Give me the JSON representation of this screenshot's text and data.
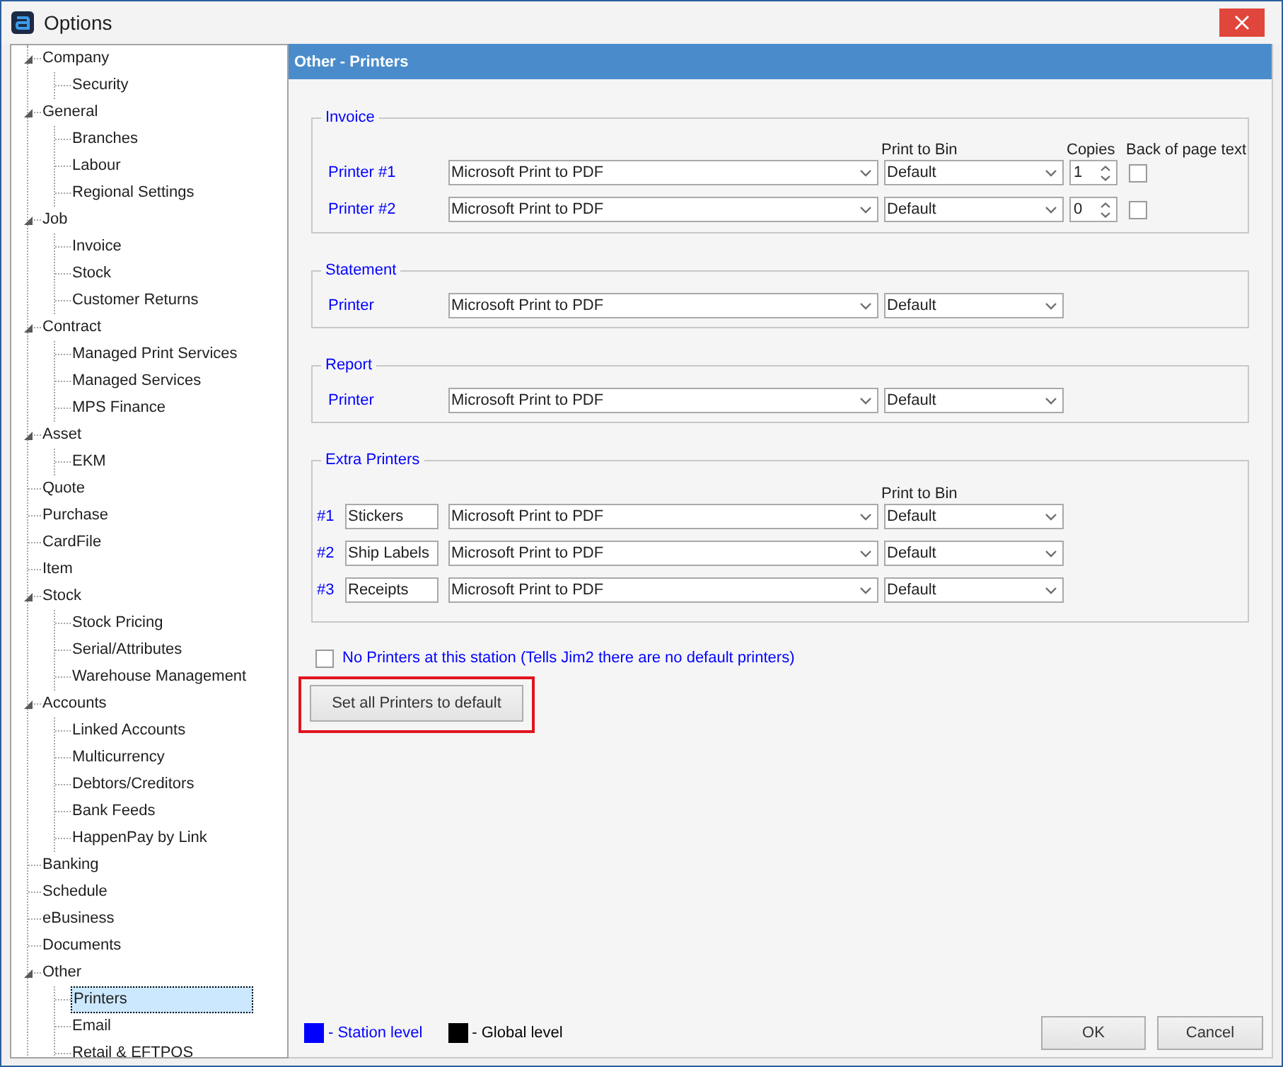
{
  "window": {
    "title": "Options"
  },
  "tree": [
    {
      "label": "Company",
      "expanded": true,
      "selected": false,
      "children": [
        {
          "label": "Security",
          "selected": false
        }
      ]
    },
    {
      "label": "General",
      "expanded": true,
      "selected": false,
      "children": [
        {
          "label": "Branches",
          "selected": false
        },
        {
          "label": "Labour",
          "selected": false
        },
        {
          "label": "Regional Settings",
          "selected": false
        }
      ]
    },
    {
      "label": "Job",
      "expanded": true,
      "selected": false,
      "children": [
        {
          "label": "Invoice",
          "selected": false
        },
        {
          "label": "Stock",
          "selected": false
        },
        {
          "label": "Customer Returns",
          "selected": false
        }
      ]
    },
    {
      "label": "Contract",
      "expanded": true,
      "selected": false,
      "children": [
        {
          "label": "Managed Print Services",
          "selected": false
        },
        {
          "label": "Managed Services",
          "selected": false
        },
        {
          "label": "MPS Finance",
          "selected": false
        }
      ]
    },
    {
      "label": "Asset",
      "expanded": true,
      "selected": false,
      "children": [
        {
          "label": "EKM",
          "selected": false
        }
      ]
    },
    {
      "label": "Quote",
      "selected": false
    },
    {
      "label": "Purchase",
      "selected": false
    },
    {
      "label": "CardFile",
      "selected": false
    },
    {
      "label": "Item",
      "selected": false
    },
    {
      "label": "Stock",
      "expanded": true,
      "selected": false,
      "children": [
        {
          "label": "Stock Pricing",
          "selected": false
        },
        {
          "label": "Serial/Attributes",
          "selected": false
        },
        {
          "label": "Warehouse Management",
          "selected": false
        }
      ]
    },
    {
      "label": "Accounts",
      "expanded": true,
      "selected": false,
      "children": [
        {
          "label": "Linked Accounts",
          "selected": false
        },
        {
          "label": "Multicurrency",
          "selected": false
        },
        {
          "label": "Debtors/Creditors",
          "selected": false
        },
        {
          "label": "Bank Feeds",
          "selected": false
        },
        {
          "label": "HappenPay by Link",
          "selected": false
        }
      ]
    },
    {
      "label": "Banking",
      "selected": false
    },
    {
      "label": "Schedule",
      "selected": false
    },
    {
      "label": "eBusiness",
      "selected": false
    },
    {
      "label": "Documents",
      "selected": false
    },
    {
      "label": "Other",
      "expanded": true,
      "selected": false,
      "children": [
        {
          "label": "Printers",
          "selected": true
        },
        {
          "label": "Email",
          "selected": false
        },
        {
          "label": "Retail & EFTPOS",
          "selected": false
        }
      ]
    }
  ],
  "panel": {
    "title": "Other - Printers"
  },
  "groups": [
    {
      "kind": "invoice",
      "title": "Invoice",
      "headers": {
        "bin": "Print to Bin",
        "copies": "Copies",
        "back": "Back of page text"
      },
      "rows": [
        {
          "label": "Printer #1",
          "printer": "Microsoft Print to PDF",
          "bin": "Default",
          "copies": "1",
          "back_text": false
        },
        {
          "label": "Printer #2",
          "printer": "Microsoft Print to PDF",
          "bin": "Default",
          "copies": "0",
          "back_text": false
        }
      ]
    },
    {
      "kind": "printer",
      "title": "Statement",
      "rows": [
        {
          "label": "Printer",
          "printer": "Microsoft Print to PDF",
          "bin": "Default"
        }
      ]
    },
    {
      "kind": "printer",
      "title": "Report",
      "rows": [
        {
          "label": "Printer",
          "printer": "Microsoft Print to PDF",
          "bin": "Default"
        }
      ]
    },
    {
      "kind": "extra",
      "title": "Extra Printers",
      "headers": {
        "bin": "Print to Bin"
      },
      "rows": [
        {
          "label": "#1",
          "name": "Stickers",
          "printer": "Microsoft Print to PDF",
          "bin": "Default"
        },
        {
          "label": "#2",
          "name": "Ship Labels",
          "printer": "Microsoft Print to PDF",
          "bin": "Default"
        },
        {
          "label": "#3",
          "name": "Receipts",
          "printer": "Microsoft Print to PDF",
          "bin": "Default"
        }
      ]
    }
  ],
  "no_printers": {
    "label": "No Printers at this station (Tells Jim2 there are no default printers)",
    "checked": false
  },
  "reset_button": {
    "label": "Set all Printers to default",
    "highlighted": true
  },
  "legend": [
    {
      "label": "- Station level",
      "color": "#0000ff"
    },
    {
      "label": "- Global level",
      "color": "#000000"
    }
  ],
  "buttons": [
    {
      "label": "OK"
    },
    {
      "label": "Cancel"
    }
  ]
}
